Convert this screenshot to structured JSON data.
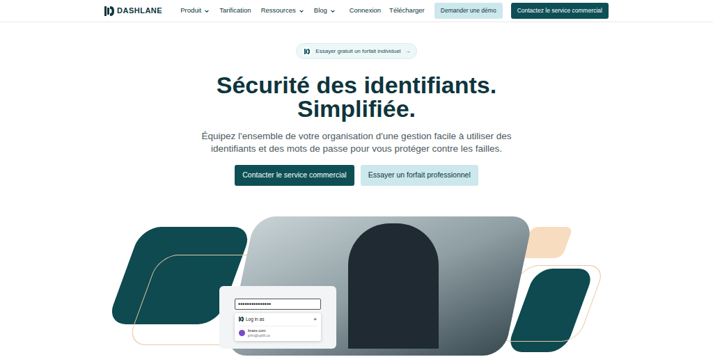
{
  "nav": {
    "logo": "DASHLANE",
    "items": [
      {
        "label": "Produit",
        "dropdown": true
      },
      {
        "label": "Tarification",
        "dropdown": false
      },
      {
        "label": "Ressources",
        "dropdown": true
      },
      {
        "label": "Blog",
        "dropdown": true
      }
    ],
    "links": [
      "Connexion",
      "Télécharger"
    ],
    "demo_button": "Demander une démo",
    "contact_button": "Contactez le service commercial"
  },
  "hero": {
    "pill": "Essayer gratuit un forfait individuel",
    "pill_arrow": "→",
    "heading": [
      "Sécurité des identifiants.",
      "Simplifiée."
    ],
    "subtitle": [
      "Équipez l'ensemble de votre organisation d'une gestion facile à utiliser des",
      "identifiants et des mots de passe pour vous protéger contre les failles."
    ],
    "primary_button": "Contacter le service commercial",
    "secondary_button": "Essayer un forfait professionnel"
  },
  "mockup": {
    "password": "•••••••••••••••",
    "popup_title": "Log in as",
    "close": "×",
    "accounts": [
      {
        "site": "braze.com",
        "email": "john@uplift.co"
      }
    ]
  }
}
